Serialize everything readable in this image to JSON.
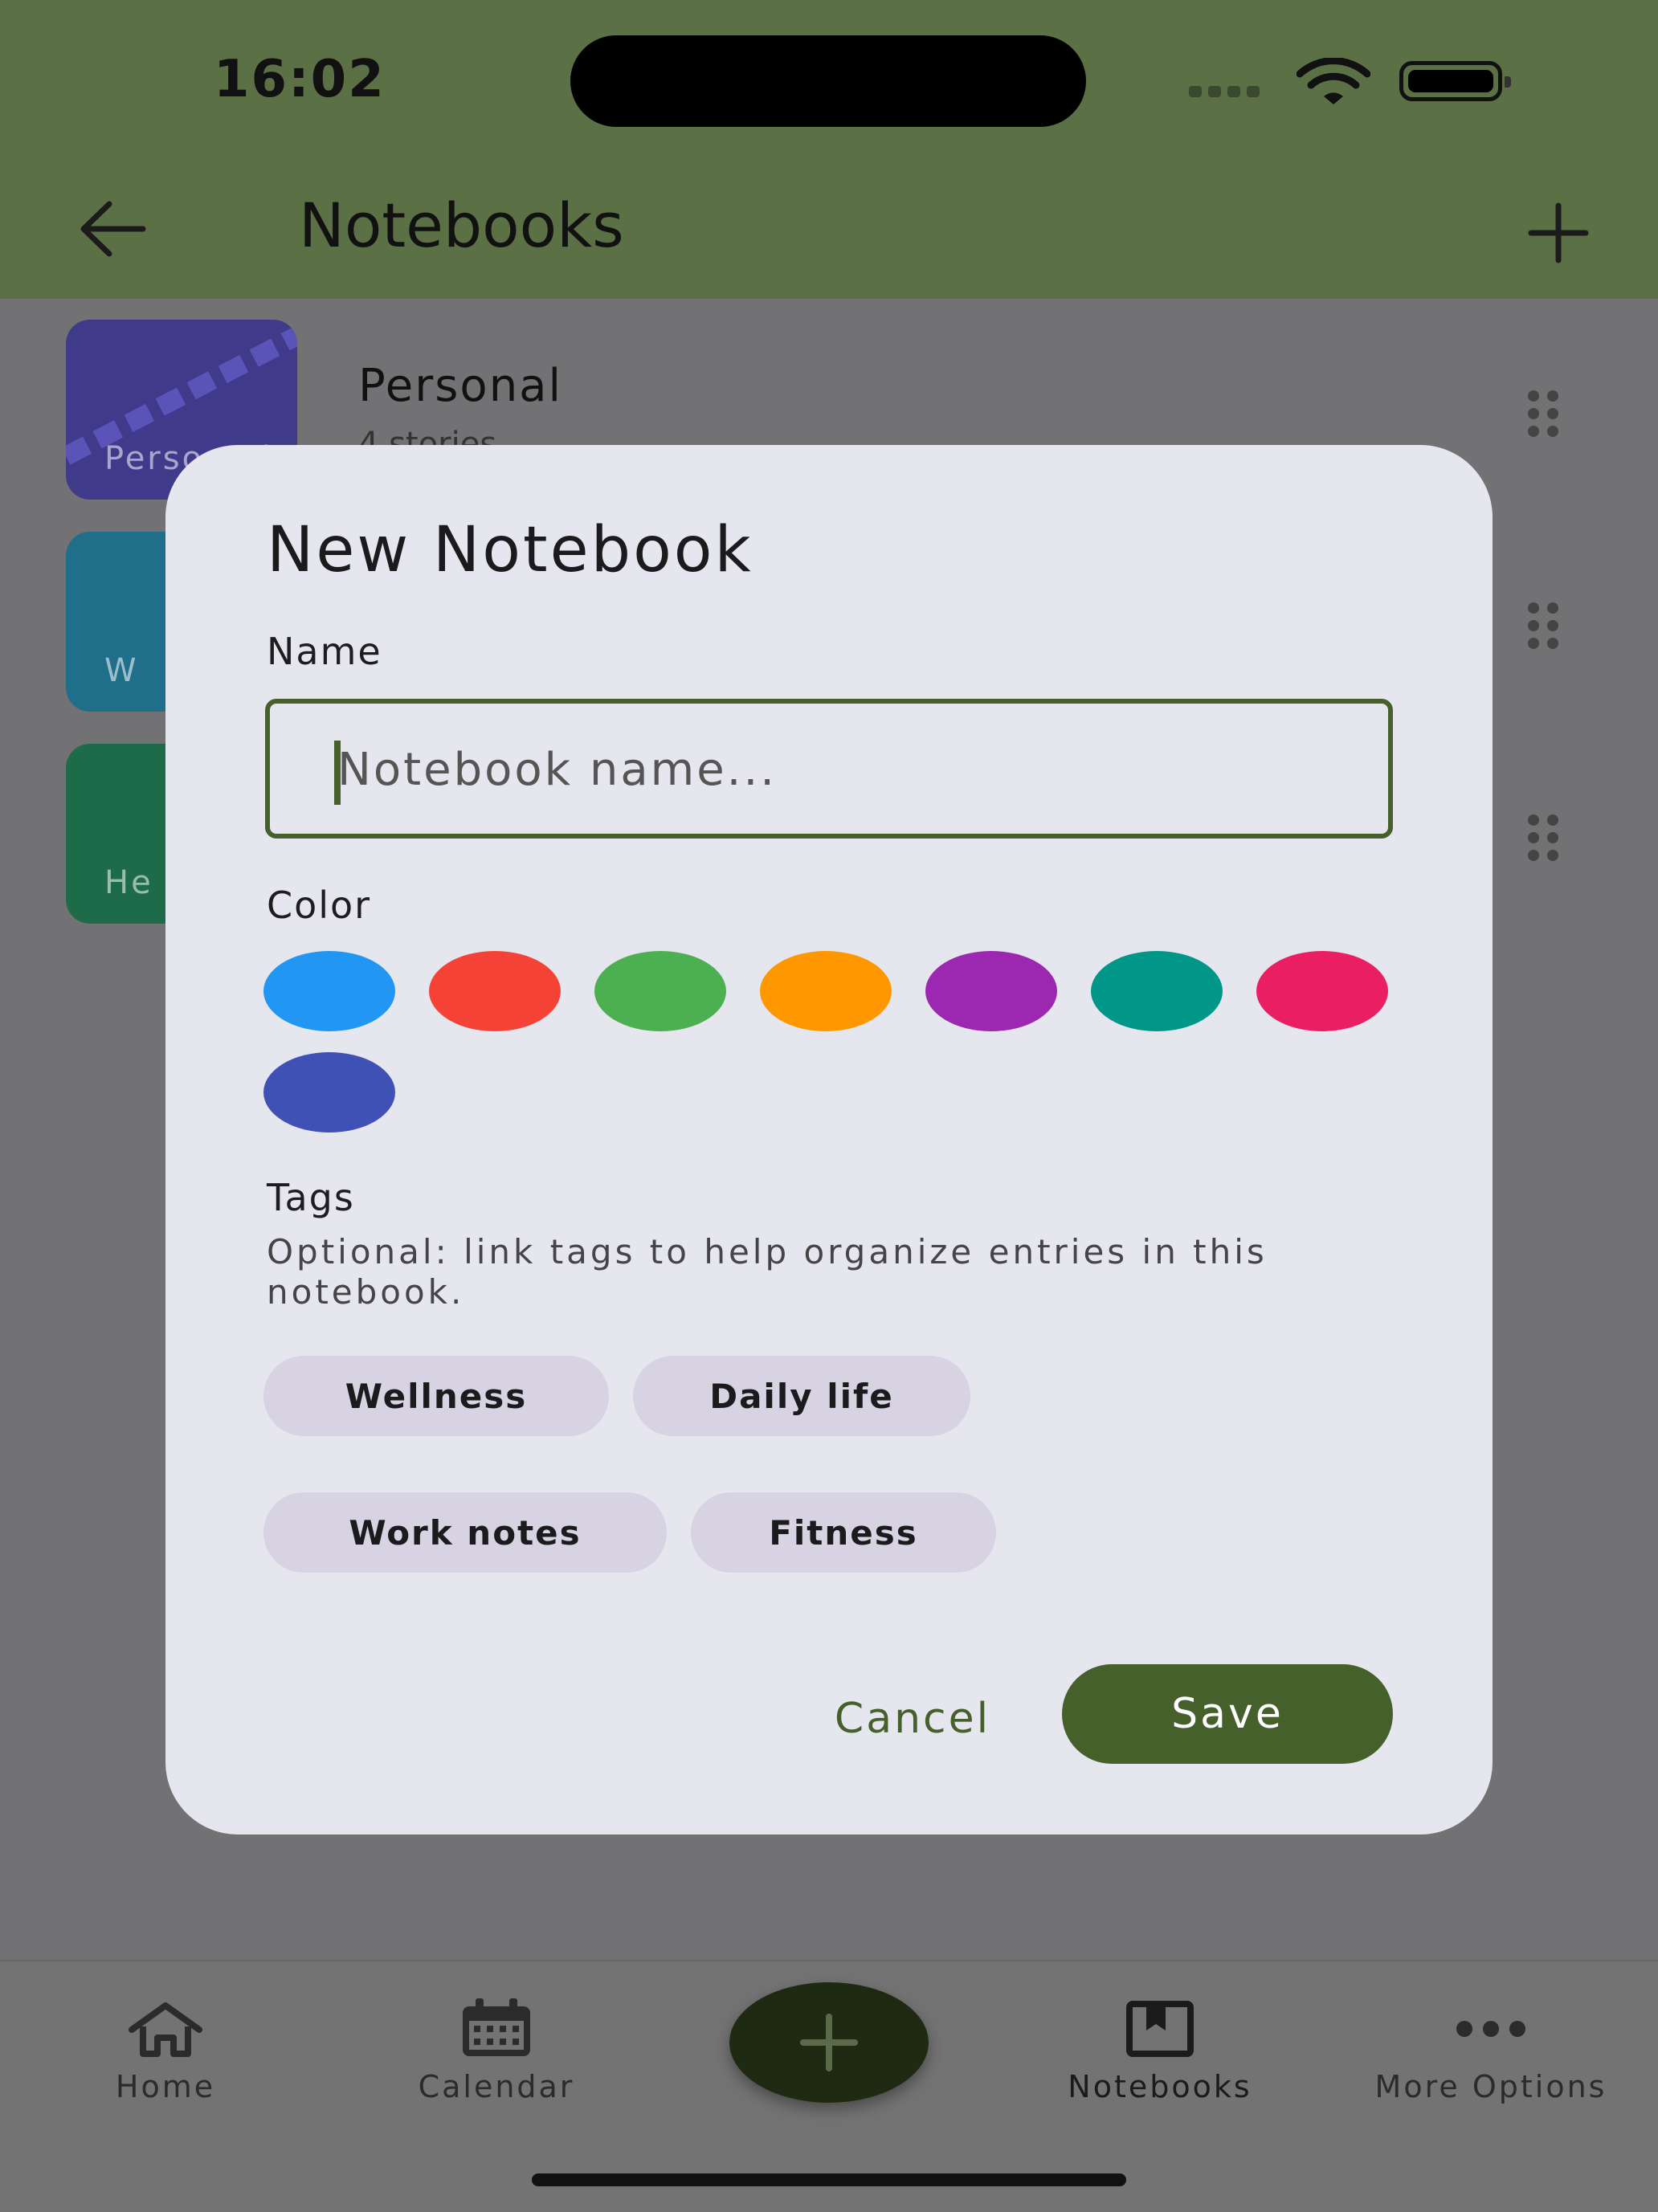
{
  "status_bar": {
    "time": "16:02"
  },
  "app_bar": {
    "title": "Notebooks"
  },
  "notebooks": [
    {
      "name": "Personal",
      "subtitle": "4 stories",
      "thumb_label": "Person al",
      "color": "#3f3a8a"
    },
    {
      "thumb_label": "W",
      "color": "#1f6f8b"
    },
    {
      "thumb_label": "He",
      "color": "#1e6b4a"
    }
  ],
  "dialog": {
    "title": "New Notebook",
    "name_label": "Name",
    "name_placeholder": "Notebook name...",
    "name_value": "",
    "color_label": "Color",
    "colors": [
      "#2196F3",
      "#F44336",
      "#4CAF50",
      "#FF9800",
      "#9C27B0",
      "#009688",
      "#E91E63",
      "#3F51B5"
    ],
    "tags_label": "Tags",
    "tags_description": "Optional: link tags to help organize entries in this notebook.",
    "tags": [
      "Wellness",
      "Daily life",
      "Work notes",
      "Fitness"
    ],
    "cancel_label": "Cancel",
    "save_label": "Save"
  },
  "bottom_nav": {
    "items": [
      {
        "label": "Home",
        "icon": "home-icon"
      },
      {
        "label": "Calendar",
        "icon": "calendar-icon"
      },
      {
        "label": "Notebooks",
        "icon": "notebook-icon",
        "active": true
      },
      {
        "label": "More Options",
        "icon": "more-icon"
      }
    ],
    "fab_icon": "plus-icon"
  },
  "theme": {
    "primary": "#45602b",
    "app_bar": "#5c7045",
    "dialog_bg": "#e6e6ef",
    "chip_bg": "#d8d3e3",
    "fab": "#1e2b12"
  }
}
